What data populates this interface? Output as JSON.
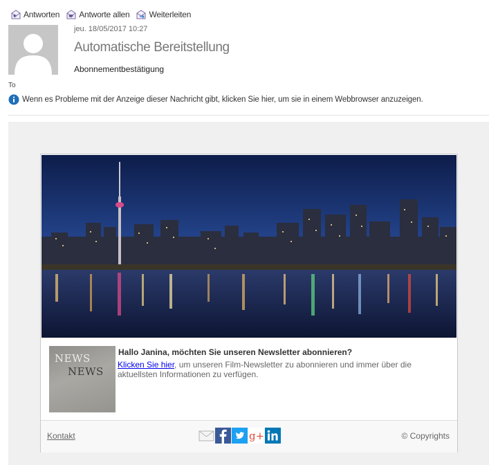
{
  "toolbar": {
    "reply": "Antworten",
    "reply_all": "Antworte allen",
    "forward": "Weiterleiten"
  },
  "message": {
    "date": "jeu. 18/05/2017 10:27",
    "sender": "Automatische Bereitstellung",
    "subject": "Abonnementbestätigung",
    "to_label": "To",
    "info_text": "Wenn es Probleme mit der Anzeige dieser Nachricht gibt, klicken Sie hier, um sie in einem Webbrowser anzuzeigen."
  },
  "newsletter": {
    "thumb_line1": "NEWS",
    "thumb_line2": "NEWS",
    "title": "Hallo Janina, möchten Sie unseren Newsletter abonnieren?",
    "link_text": "Klicken Sie hier",
    "text_rest": ", um unseren Film-Newsletter zu abonnieren und immer über die aktuellsten Informationen zu verfügen."
  },
  "footer": {
    "contact": "Kontakt",
    "copyright": "© Copyrights",
    "social": [
      "mail-icon",
      "facebook-icon",
      "twitter-icon",
      "google-plus-icon",
      "linkedin-icon"
    ]
  },
  "colors": {
    "facebook": "#3b5998",
    "twitter": "#1da1f2",
    "google_plus": "#dd4b39",
    "linkedin": "#0077b5",
    "link": "#0000ee",
    "info_icon": "#1e6fb8"
  }
}
